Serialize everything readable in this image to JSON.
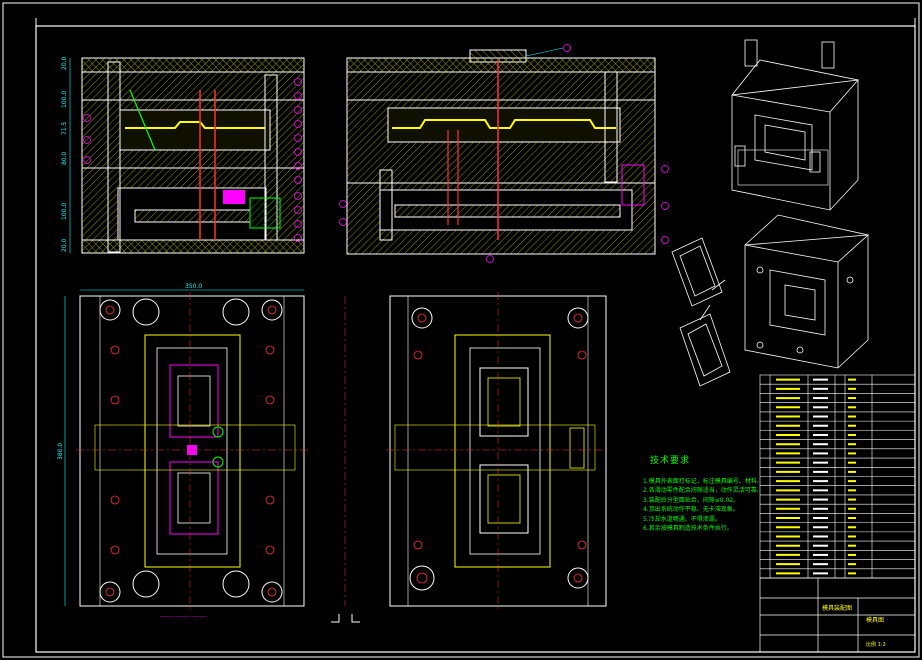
{
  "drawing": {
    "technical_requirements_title": "技术要求",
    "technical_requirements": [
      "1.模具外表面打标记，标注模具编号、材料。",
      "2.各滑动零件配合间隙适当，动作灵活可靠。",
      "3.装配后分型面贴合，间隙≤0.02。",
      "4.顶出系统动作平稳、无卡滞现象。",
      "5.冷却水道畅通、不得渗漏。",
      "6.其余按模具制造技术条件执行。"
    ],
    "dimensions": {
      "plan_width": "350.0",
      "plan_height": "380.0",
      "section_heights": [
        "20.0",
        "100.0",
        "71.5",
        "80.0",
        "100.0",
        "20.0"
      ]
    },
    "title_block": {
      "drawing_name": "模具装配图",
      "title": "模具图",
      "scale_label": "比例 1:2"
    },
    "bottom_note": "-------- -------- --------",
    "colors": {
      "background": "#000000",
      "outline": "#ffffff",
      "hatch": "#ffff00",
      "accent_cyan": "#00ffff",
      "accent_magenta": "#ff00ff",
      "accent_green": "#00ff00",
      "accent_red": "#ff3030"
    }
  }
}
